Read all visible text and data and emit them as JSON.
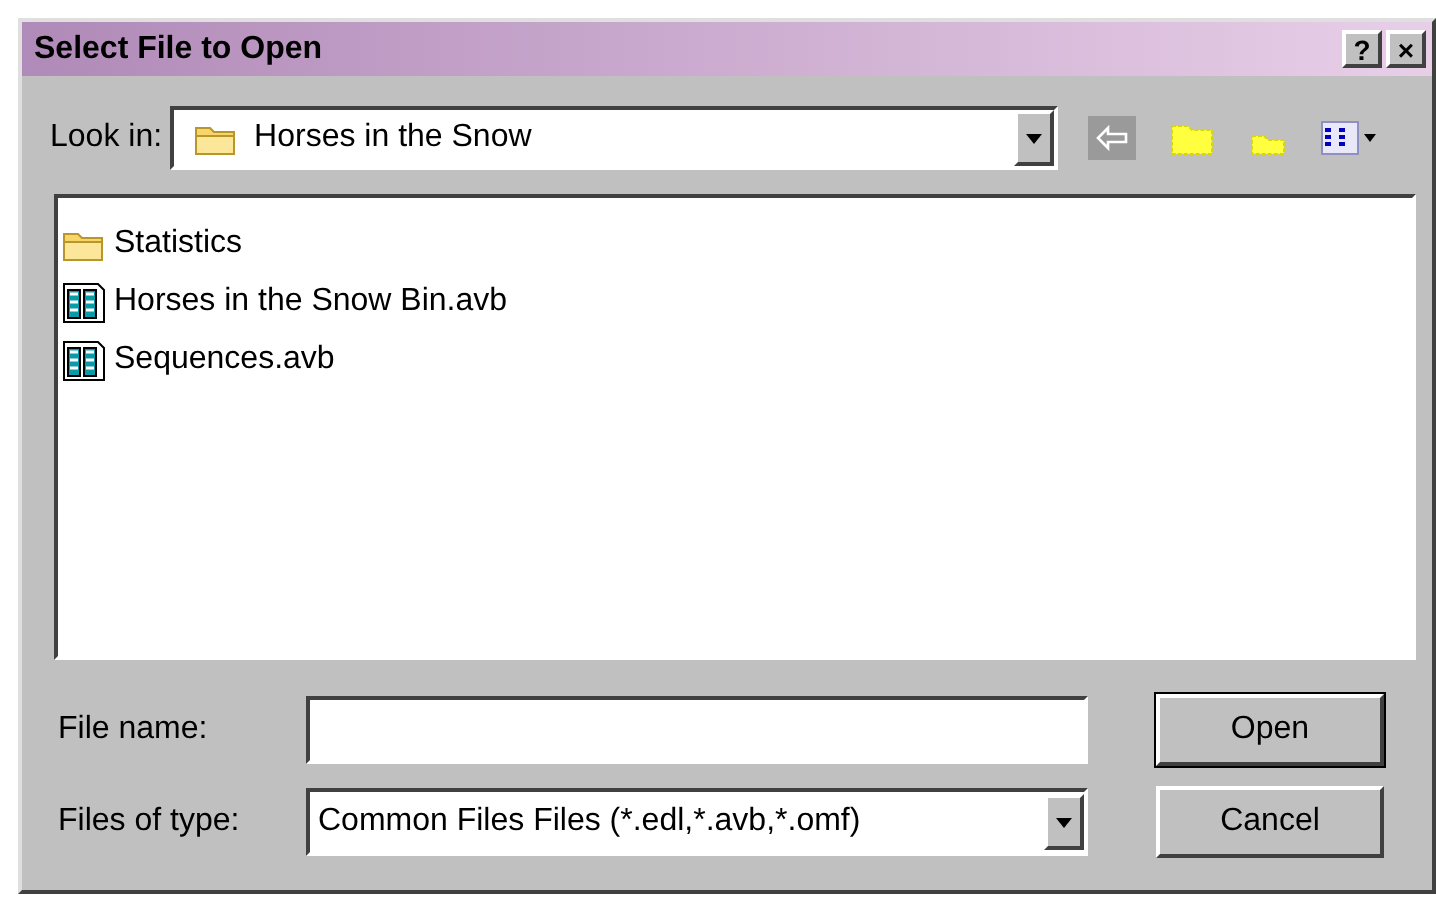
{
  "window": {
    "title": "Select File to Open",
    "title_buttons": [
      "?",
      "×"
    ]
  },
  "look_in": {
    "label": "Look in:",
    "value": "Horses in the Snow"
  },
  "toolbar": [
    {
      "kind": "back",
      "disabled": true
    },
    {
      "kind": "up",
      "disabled": false
    },
    {
      "kind": "newfolder",
      "disabled": false
    },
    {
      "kind": "views",
      "disabled": false
    }
  ],
  "files": [
    {
      "kind": "folder",
      "name": "Statistics"
    },
    {
      "kind": "bin",
      "name": "Horses in the Snow Bin.avb"
    },
    {
      "kind": "bin",
      "name": "Sequences.avb"
    }
  ],
  "file_name": {
    "label": "File name:"
  },
  "file_type": {
    "label": "Files of type:",
    "value": "Common Files Files (*.edl,*.avb,*.omf)"
  },
  "buttons": [
    "Open",
    "Cancel"
  ]
}
